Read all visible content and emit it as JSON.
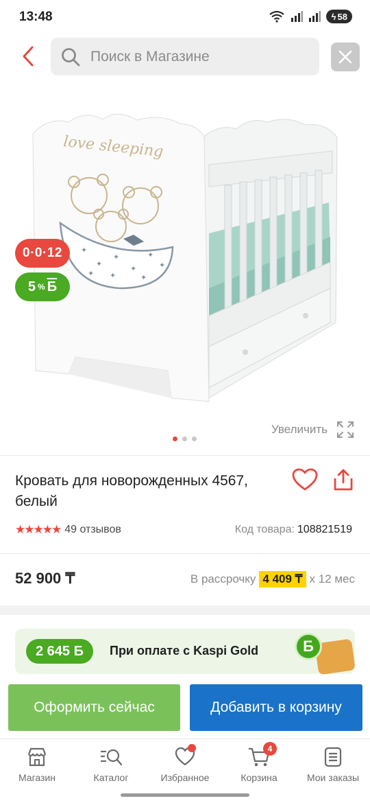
{
  "status_bar": {
    "time": "13:48",
    "battery": "58"
  },
  "search": {
    "placeholder": "Поиск в Магазине"
  },
  "gallery": {
    "installment_badge": "0·0·12",
    "bonus_badge_value": "5",
    "bonus_badge_unit": "%",
    "bonus_badge_symbol": "Б",
    "bed_text": "love sleeping",
    "zoom_label": "Увеличить"
  },
  "product": {
    "title": "Кровать для новорожденных 4567, белый",
    "stars": "★★★★★",
    "reviews": "49 отзывов",
    "code_label": "Код товара:",
    "code_value": "108821519",
    "price": "52 900 ₸",
    "installment_prefix": "В рассрочку",
    "installment_amount": "4 409 ₸",
    "installment_suffix": "х 12 мес"
  },
  "kaspi_gold": {
    "bonus": "2 645 Б",
    "text": "При оплате с Kaspi Gold",
    "coin_symbol": "Б"
  },
  "actions": {
    "buy_now": "Оформить сейчас",
    "add_to_cart": "Добавить в корзину"
  },
  "nav": {
    "items": [
      {
        "label": "Магазин",
        "icon": "shop-icon"
      },
      {
        "label": "Каталог",
        "icon": "catalog-search-icon"
      },
      {
        "label": "Избранное",
        "icon": "heart-icon"
      },
      {
        "label": "Корзина",
        "icon": "cart-icon",
        "badge": "4"
      },
      {
        "label": "Мои заказы",
        "icon": "orders-icon"
      }
    ]
  },
  "colors": {
    "accent_red": "#e8483e",
    "kaspi_green": "#4aaa22",
    "button_green": "#7bc15a",
    "button_blue": "#1a73c8",
    "highlight_yellow": "#ffd200"
  }
}
